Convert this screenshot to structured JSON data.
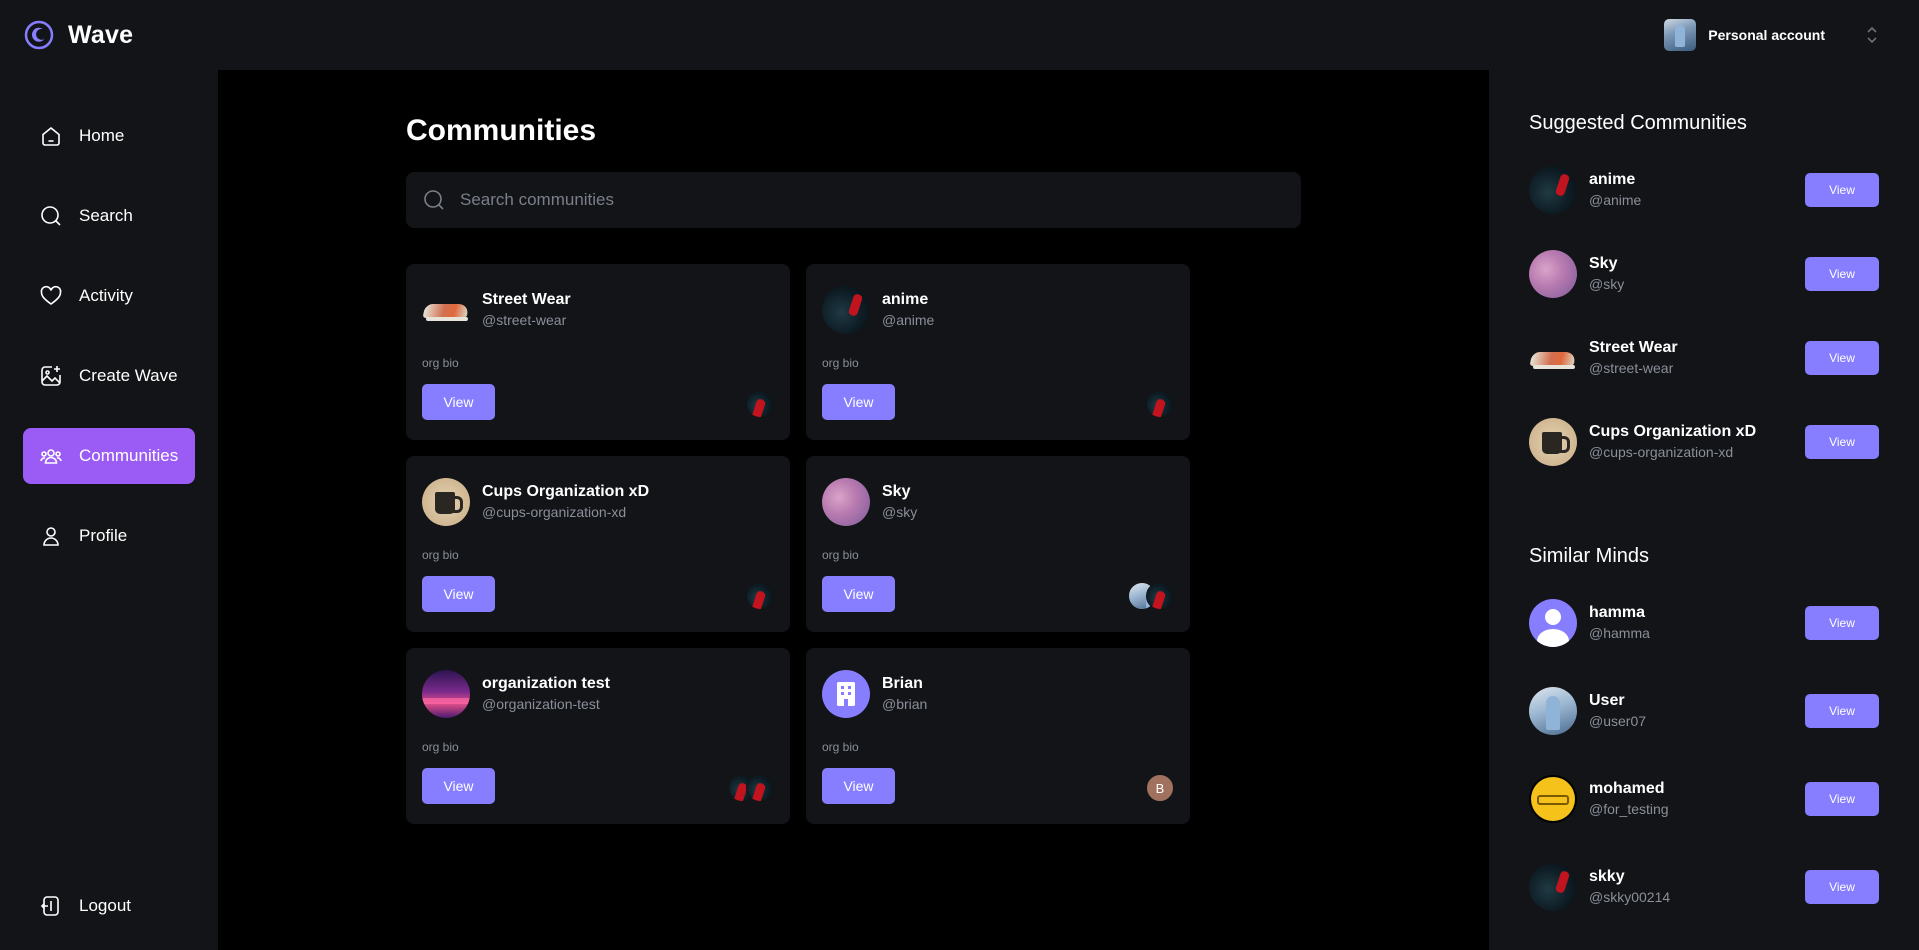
{
  "app": {
    "name": "Wave"
  },
  "account": {
    "label": "Personal account"
  },
  "nav": {
    "items": [
      {
        "id": "home",
        "label": "Home",
        "icon": "home-icon"
      },
      {
        "id": "search",
        "label": "Search",
        "icon": "search-icon"
      },
      {
        "id": "activity",
        "label": "Activity",
        "icon": "heart-icon"
      },
      {
        "id": "create-wave",
        "label": "Create Wave",
        "icon": "create-image-icon"
      },
      {
        "id": "communities",
        "label": "Communities",
        "icon": "people-icon",
        "active": true
      },
      {
        "id": "profile",
        "label": "Profile",
        "icon": "user-icon"
      }
    ],
    "logout": "Logout"
  },
  "main": {
    "title": "Communities",
    "search": {
      "placeholder": "Search communities",
      "value": ""
    },
    "view_label": "View",
    "communities": [
      {
        "name": "Street Wear",
        "handle": "@street-wear",
        "bio": "org bio",
        "avatar": "sneaker-avatar",
        "members": [
          "anime-avatar"
        ]
      },
      {
        "name": "anime",
        "handle": "@anime",
        "bio": "org bio",
        "avatar": "anime-avatar",
        "members": [
          "anime-avatar"
        ]
      },
      {
        "name": "Cups Organization xD",
        "handle": "@cups-organization-xd",
        "bio": "org bio",
        "avatar": "cup-avatar",
        "members": [
          "anime-avatar"
        ]
      },
      {
        "name": "Sky",
        "handle": "@sky",
        "bio": "org bio",
        "avatar": "sky-avatar",
        "members": [
          "user-avatar",
          "anime-avatar"
        ]
      },
      {
        "name": "organization test",
        "handle": "@organization-test",
        "bio": "org bio",
        "avatar": "neon-avatar",
        "members": [
          "anime-avatar",
          "anime-avatar"
        ]
      },
      {
        "name": "Brian",
        "handle": "@brian",
        "bio": "org bio",
        "avatar": "building-avatar",
        "members": [
          "B"
        ]
      }
    ]
  },
  "suggested": {
    "title": "Suggested Communities",
    "view_label": "View",
    "items": [
      {
        "name": "anime",
        "handle": "@anime",
        "avatar": "anime-avatar"
      },
      {
        "name": "Sky",
        "handle": "@sky",
        "avatar": "sky-avatar"
      },
      {
        "name": "Street Wear",
        "handle": "@street-wear",
        "avatar": "sneaker-avatar"
      },
      {
        "name": "Cups Organization xD",
        "handle": "@cups-organization-xd",
        "avatar": "cup-avatar"
      }
    ]
  },
  "similar": {
    "title": "Similar Minds",
    "view_label": "View",
    "items": [
      {
        "name": "hamma",
        "handle": "@hamma",
        "avatar": "default-user-avatar"
      },
      {
        "name": "User",
        "handle": "@user07",
        "avatar": "user-avatar"
      },
      {
        "name": "mohamed",
        "handle": "@for_testing",
        "avatar": "emoji-avatar"
      },
      {
        "name": "skky",
        "handle": "@skky00214",
        "avatar": "anime-avatar"
      }
    ]
  },
  "colors": {
    "accent": "#877eff",
    "active_nav": "#9b5cf5",
    "panel": "#121417",
    "background": "#000000"
  }
}
